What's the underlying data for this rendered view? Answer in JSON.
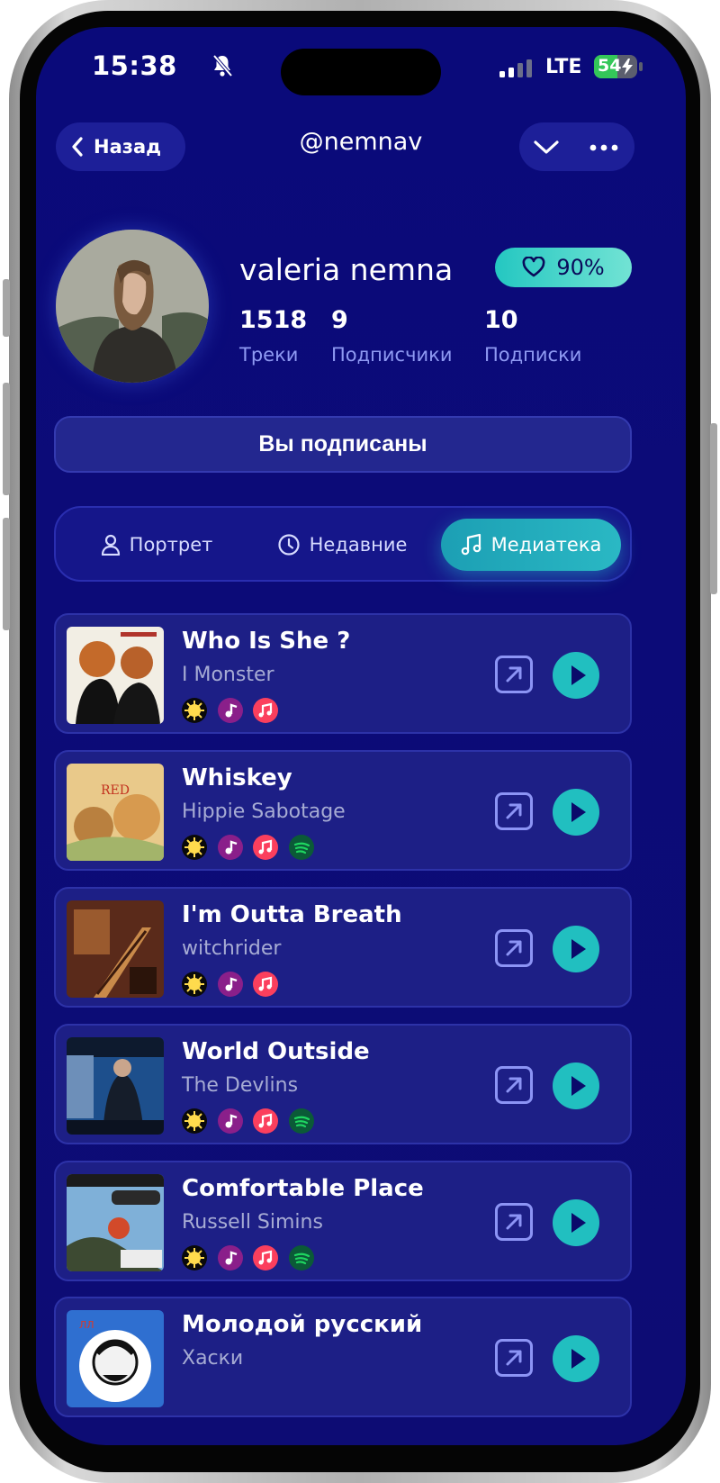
{
  "status_bar": {
    "time": "15:38",
    "network": "LTE",
    "battery": "54",
    "battery_level": 0.54
  },
  "header": {
    "back_label": "Назад",
    "handle": "@nemnav"
  },
  "profile": {
    "name": "valeria nemna",
    "match": "90%",
    "stats": [
      {
        "value": "1518",
        "label": "Треки"
      },
      {
        "value": "9",
        "label": "Подписчики"
      },
      {
        "value": "10",
        "label": "Подписки"
      }
    ]
  },
  "subscribe_label": "Вы подписаны",
  "tabs": [
    {
      "label": "Портрет",
      "icon": "person-icon",
      "active": false
    },
    {
      "label": "Недавние",
      "icon": "clock-icon",
      "active": false
    },
    {
      "label": "Медиатека",
      "icon": "music-note-icon",
      "active": true
    }
  ],
  "tracks": [
    {
      "title": "Who Is She ?",
      "artist": "I Monster",
      "services": [
        "yandex-music",
        "zvuk",
        "apple-music"
      ]
    },
    {
      "title": "Whiskey",
      "artist": "Hippie Sabotage",
      "services": [
        "yandex-music",
        "zvuk",
        "apple-music",
        "spotify"
      ]
    },
    {
      "title": "I'm Outta Breath",
      "artist": "witchrider",
      "services": [
        "yandex-music",
        "zvuk",
        "apple-music"
      ]
    },
    {
      "title": "World Outside",
      "artist": "The Devlins",
      "services": [
        "yandex-music",
        "zvuk",
        "apple-music",
        "spotify"
      ]
    },
    {
      "title": "Comfortable Place",
      "artist": "Russell Simins",
      "services": [
        "yandex-music",
        "zvuk",
        "apple-music",
        "spotify"
      ]
    },
    {
      "title": "Молодой русский",
      "artist": "Хаски",
      "services": []
    }
  ],
  "colors": {
    "background": "#0b0a78",
    "card": "#1d1f86",
    "accent": "#21bfc0",
    "label": "#8f9af3",
    "match_gradient_end": "#72e3d4"
  }
}
